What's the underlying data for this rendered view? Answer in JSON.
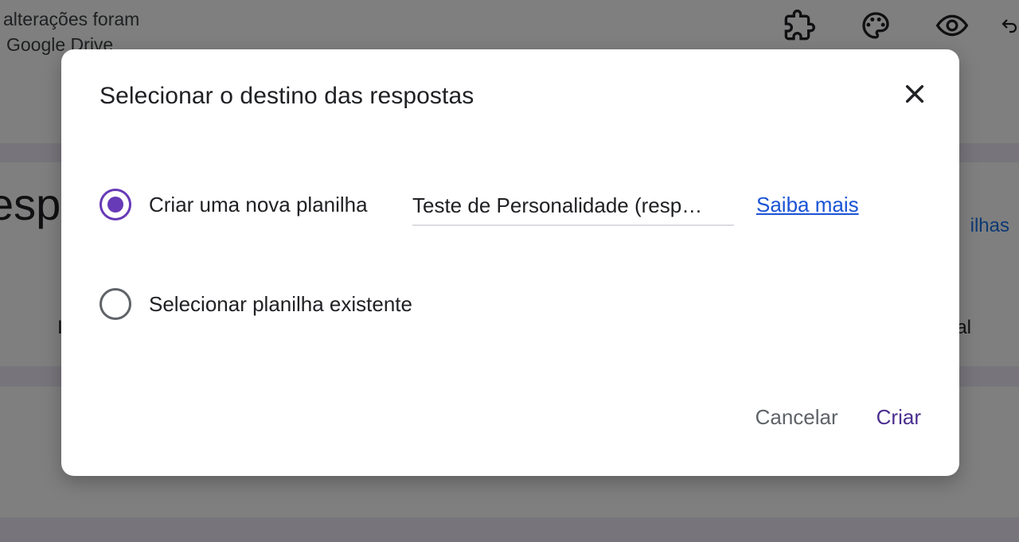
{
  "background": {
    "status_line1": "alterações foram",
    "status_line2": "Google Drive",
    "heading_fragment": "espo",
    "link_fragment": "ilhas",
    "left_marker": "I",
    "right_marker": "al",
    "toolbar_icons": [
      "puzzle-icon",
      "palette-icon",
      "eye-icon",
      "undo-icon"
    ]
  },
  "dialog": {
    "title": "Selecionar o destino das respostas",
    "close_label": "×",
    "options": [
      {
        "label": "Criar uma nova planilha",
        "checked": true
      },
      {
        "label": "Selecionar planilha existente",
        "checked": false
      }
    ],
    "spreadsheet_name": "Teste de Personalidade (resp…",
    "learn_more": "Saiba mais",
    "cancel": "Cancelar",
    "create": "Criar"
  },
  "colors": {
    "accent": "#673ab7",
    "link": "#1a53d6",
    "create_text": "#4b2f8f",
    "band": "#efeaf6"
  }
}
